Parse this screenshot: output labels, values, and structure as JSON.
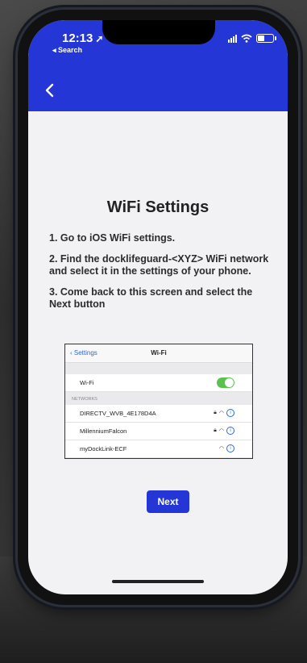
{
  "status_bar": {
    "time": "12:13",
    "location_icon": "location-arrow-icon",
    "back_app": "◂ Search"
  },
  "nav": {
    "back_icon": "chevron-left-icon"
  },
  "page": {
    "title": "WiFi Settings",
    "steps": [
      "1. Go to iOS WiFi settings.",
      "2. Find the docklifeguard-<XYZ> WiFi network and select it in the settings of your phone.",
      "3. Come back to this screen and select the Next button"
    ],
    "next_label": "Next"
  },
  "embedded_screenshot": {
    "back_label": "Settings",
    "title": "Wi-Fi",
    "wifi_label": "Wi-Fi",
    "wifi_on": true,
    "section_label": "NETWORKS",
    "networks": [
      "DIRECTV_WVB_4E178D4A",
      "MillenniumFalcon",
      "myDockLink-ECF"
    ]
  },
  "colors": {
    "accent": "#2536d6",
    "background": "#f2f2f4",
    "toggle": "#5bc04e"
  }
}
